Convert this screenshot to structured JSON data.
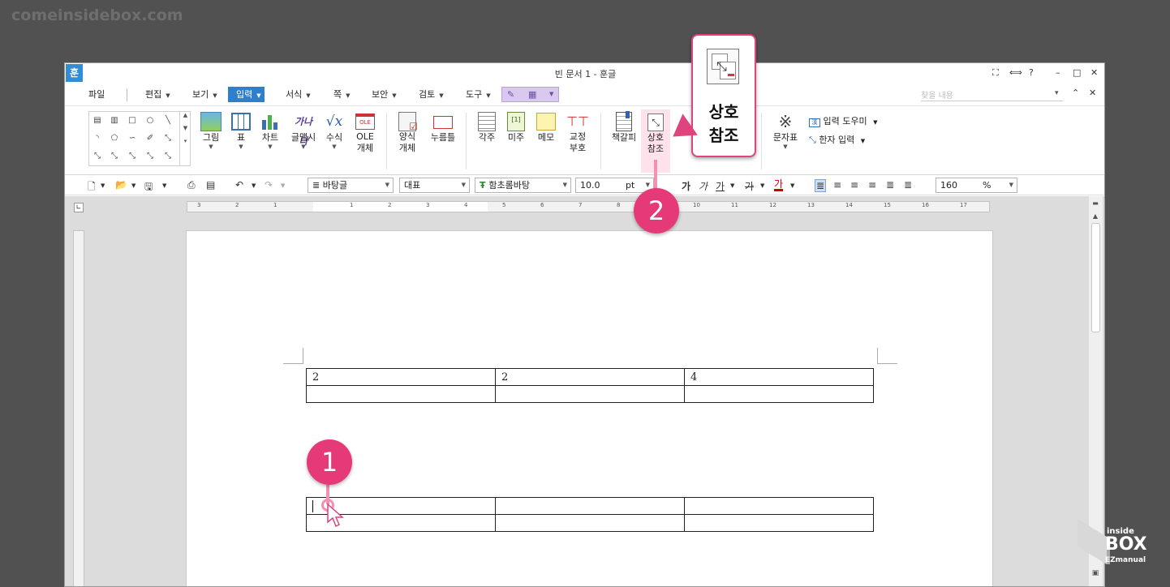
{
  "watermark": "comeinsidebox.com",
  "window": {
    "title": "빈 문서 1 - 훈글",
    "logo": "훈",
    "controls": [
      "⛶",
      "⟺",
      "?",
      "–",
      "□",
      "✕"
    ]
  },
  "menu": {
    "items": [
      "파일",
      "편집",
      "보기",
      "입력",
      "서식",
      "쪽",
      "보안",
      "검토",
      "도구"
    ],
    "active": "입력",
    "search_placeholder": "찾을 내용"
  },
  "ribbon": {
    "groups": [
      {
        "label": "그림"
      },
      {
        "label": "표"
      },
      {
        "label": "차트"
      },
      {
        "label": "글맵시"
      },
      {
        "label": "수식"
      },
      {
        "label": "OLE\n개체"
      },
      {
        "label": "양식\n개체"
      },
      {
        "label": "누름틀"
      },
      {
        "label": "각주"
      },
      {
        "label": "미주"
      },
      {
        "label": "메모"
      },
      {
        "label": "교정\n부호"
      },
      {
        "label": "책갈피"
      },
      {
        "label": "상호\n참조"
      },
      {
        "label": "문자표"
      }
    ],
    "input_helper": "입력 도우미",
    "hanja_input": "한자 입력"
  },
  "toolbar": {
    "style": "바탕글",
    "lang": "대표",
    "font": "함초롬바탕",
    "size": "10.0",
    "unit": "pt",
    "zoom": "160",
    "zoom_unit": "%"
  },
  "ruler": {
    "h_ticks": [
      "3",
      "2",
      "1",
      "1",
      "2",
      "3",
      "4",
      "5",
      "6",
      "7",
      "8",
      "9",
      "10",
      "11",
      "12",
      "13",
      "14",
      "15",
      "16",
      "17"
    ]
  },
  "document": {
    "table1": [
      [
        "2",
        "2",
        "4"
      ],
      [
        "",
        "",
        ""
      ]
    ],
    "table2": [
      [
        "",
        "",
        ""
      ],
      [
        "",
        "",
        ""
      ]
    ]
  },
  "callout": {
    "label": "상호\n참조"
  },
  "badges": {
    "step1": "1",
    "step2": "2"
  },
  "brand": {
    "top": "inside",
    "mid": "BOX",
    "bottom": "EZmanual"
  },
  "colors": {
    "accent": "#2e7fcc",
    "highlight": "#e63978"
  }
}
